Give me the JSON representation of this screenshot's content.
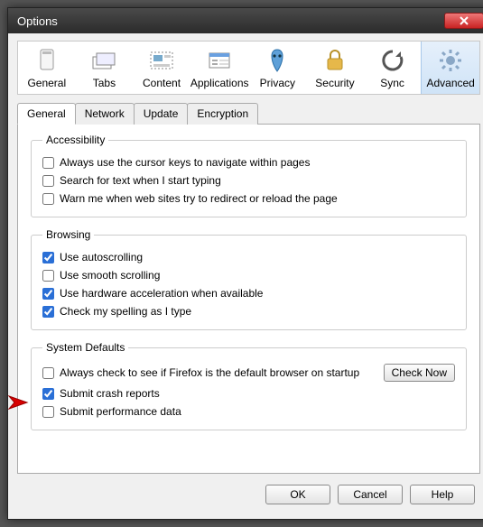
{
  "title": "Options",
  "toolbar": [
    {
      "id": "general",
      "label": "General",
      "icon": "general-icon"
    },
    {
      "id": "tabs",
      "label": "Tabs",
      "icon": "tabs-icon"
    },
    {
      "id": "content",
      "label": "Content",
      "icon": "content-icon"
    },
    {
      "id": "applications",
      "label": "Applications",
      "icon": "applications-icon"
    },
    {
      "id": "privacy",
      "label": "Privacy",
      "icon": "privacy-icon"
    },
    {
      "id": "security",
      "label": "Security",
      "icon": "security-icon"
    },
    {
      "id": "sync",
      "label": "Sync",
      "icon": "sync-icon"
    },
    {
      "id": "advanced",
      "label": "Advanced",
      "icon": "advanced-icon",
      "selected": true
    }
  ],
  "sub_tabs": [
    {
      "id": "general",
      "label": "General",
      "active": true
    },
    {
      "id": "network",
      "label": "Network"
    },
    {
      "id": "update",
      "label": "Update"
    },
    {
      "id": "encryption",
      "label": "Encryption"
    }
  ],
  "groups": {
    "accessibility": {
      "legend": "Accessibility",
      "items": [
        {
          "label": "Always use the cursor keys to navigate within pages",
          "checked": false
        },
        {
          "label": "Search for text when I start typing",
          "checked": false
        },
        {
          "label": "Warn me when web sites try to redirect or reload the page",
          "checked": false
        }
      ]
    },
    "browsing": {
      "legend": "Browsing",
      "items": [
        {
          "label": "Use autoscrolling",
          "checked": true
        },
        {
          "label": "Use smooth scrolling",
          "checked": false
        },
        {
          "label": "Use hardware acceleration when available",
          "checked": true
        },
        {
          "label": "Check my spelling as I type",
          "checked": true
        }
      ]
    },
    "system_defaults": {
      "legend": "System Defaults",
      "check_now": "Check Now",
      "items": [
        {
          "label": "Always check to see if Firefox is the default browser on startup",
          "checked": false,
          "has_btn": true
        },
        {
          "label": "Submit crash reports",
          "checked": true
        },
        {
          "label": "Submit performance data",
          "checked": false
        }
      ]
    }
  },
  "footer": {
    "ok": "OK",
    "cancel": "Cancel",
    "help": "Help"
  }
}
